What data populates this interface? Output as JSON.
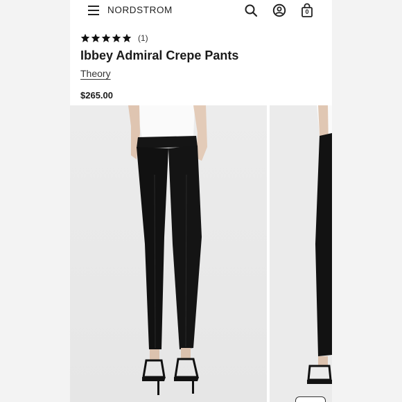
{
  "header": {
    "brand": "NORDSTROM",
    "menu_icon": "hamburger-menu-icon",
    "search_icon": "search-icon",
    "account_icon": "account-icon",
    "bag_icon": "shopping-bag-icon",
    "bag_count": "0"
  },
  "product": {
    "rating": {
      "stars": 5,
      "review_count": "(1)"
    },
    "title": "Ibbey Admiral Crepe Pants",
    "brand": "Theory",
    "price": "$265.00"
  },
  "gallery": {
    "images": [
      {
        "name": "front-view-photo"
      },
      {
        "name": "side-view-photo"
      }
    ]
  },
  "colors": {
    "text": "#1a1a1a",
    "pants": "#111111",
    "top": "#ffffff",
    "photo_bg": "#ececec"
  }
}
